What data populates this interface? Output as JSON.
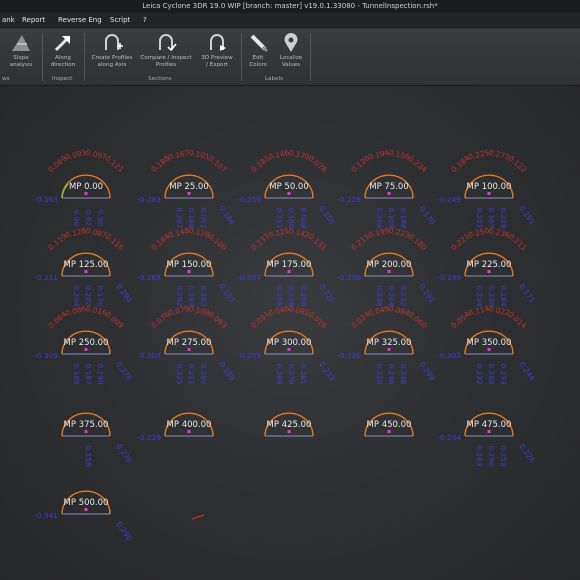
{
  "title": "Leica Cyclone 3DR 19.0 WIP [branch: master] v19.0.1.33080 - TunnelInspection.rsh*",
  "menu": [
    "ank",
    "Report",
    "Reverse Eng",
    "Script",
    "?"
  ],
  "ribbon": {
    "buttons": [
      {
        "label": "Slope\nanalysis",
        "icon": "slope-icon"
      },
      {
        "label": "Along\ndirection",
        "icon": "arrow-icon"
      },
      {
        "label": "Create Profiles\nalong Axis",
        "icon": "profile-add-icon"
      },
      {
        "label": "Compare / Inspect\nProfiles",
        "icon": "profile-check-icon"
      },
      {
        "label": "3D Preview\n/ Export",
        "icon": "profile-export-icon"
      },
      {
        "label": "Edit\nColors",
        "icon": "edit-colors-icon"
      },
      {
        "label": "Localize\nValues",
        "icon": "localize-icon"
      }
    ],
    "groups": [
      "ws",
      "Inspect",
      "Sections",
      "Labels"
    ]
  },
  "colors": {
    "profile_line": "#e07a24",
    "over_label": "#c0322c",
    "under_label": "#3d3fcf",
    "marker": "#e13ad0",
    "ok_line": "#8cbf3a"
  },
  "profiles": [
    {
      "name": "MP 0.00",
      "red": [
        "0.069",
        "0.093",
        "0.097",
        "0.121"
      ],
      "blue": [
        "0.00",
        "0.02",
        "0.00"
      ],
      "left": "0.163",
      "right": ""
    },
    {
      "name": "MP 25.00",
      "red": [
        "0.188",
        "0.167",
        "0.101",
        "0.107"
      ],
      "blue": [
        "0.207",
        "0.168",
        "0.051"
      ],
      "left": "0.283",
      "right": "0.184"
    },
    {
      "name": "MP 50.00",
      "red": [
        "0.181",
        "0.146",
        "0.170",
        "0.078"
      ],
      "blue": [
        "0.251",
        "0.166",
        "0.008"
      ],
      "left": "0.259",
      "right": "0.100"
    },
    {
      "name": "MP 75.00",
      "red": [
        "0.120",
        "0.194",
        "0.156",
        "0.234"
      ],
      "blue": [
        "0.264",
        "0.109",
        "0.198"
      ],
      "left": "0.229",
      "right": "0.170"
    },
    {
      "name": "MP 100.00",
      "red": [
        "0.184",
        "0.225",
        "0.273",
        "0.122"
      ],
      "blue": [
        "0.222",
        "0.167",
        "0.228"
      ],
      "left": "0.249",
      "right": "0.191"
    },
    {
      "name": "MP 125.00",
      "red": [
        "0.119",
        "0.128",
        "0.087",
        "0.116"
      ],
      "blue": [
        "0.204",
        "0.202",
        "0.170"
      ],
      "left": "0.211",
      "right": "0.294"
    },
    {
      "name": "MP 150.00",
      "red": [
        "0.164",
        "0.148",
        "0.128",
        "0.100"
      ],
      "blue": [
        "0.292",
        "0.193",
        "0.163"
      ],
      "left": "0.265",
      "right": "0.157"
    },
    {
      "name": "MP 175.00",
      "red": [
        "0.137",
        "0.121",
        "0.142",
        "0.131"
      ],
      "blue": [
        "0.208",
        "0.248",
        "0.208"
      ],
      "left": "0.267",
      "right": "0.220"
    },
    {
      "name": "MP 200.00",
      "red": [
        "0.211",
        "0.199",
        "0.223",
        "0.180"
      ],
      "blue": [
        "0.236",
        "0.204",
        "0.232"
      ],
      "left": "0.236",
      "right": "0.191"
    },
    {
      "name": "MP 225.00",
      "red": [
        "0.221",
        "0.250",
        "0.236",
        "0.211"
      ],
      "blue": [
        "0.234",
        "0.230",
        "0.184"
      ],
      "left": "0.199",
      "right": "0.175"
    },
    {
      "name": "MP 250.00",
      "red": [
        "0.064",
        "0.086",
        "0.016",
        "0.009"
      ],
      "blue": [
        "0.189",
        "0.187",
        "0.190"
      ],
      "left": "0.309",
      "right": "0.276"
    },
    {
      "name": "MP 275.00",
      "red": [
        "0.076",
        "0.079",
        "0.109",
        "0.093"
      ],
      "blue": [
        "0.325",
        "0.211",
        "0.192"
      ],
      "left": "0.307",
      "right": "0.159"
    },
    {
      "name": "MP 300.00",
      "red": [
        "0.091",
        "0.046",
        "0.082",
        "0.018"
      ],
      "blue": [
        "0.289",
        "0.278",
        "0.261"
      ],
      "left": "0.259",
      "right": "0.233"
    },
    {
      "name": "MP 325.00",
      "red": [
        "0.024",
        "0.049",
        "0.084",
        "0.060"
      ],
      "blue": [
        "0.220",
        "0.236",
        "0.246"
      ],
      "left": "0.230",
      "right": "0.298"
    },
    {
      "name": "MP 350.00",
      "red": [
        "0.054",
        "0.114",
        "0.022",
        "0.014"
      ],
      "blue": [
        "0.232",
        "0.288",
        "0.233"
      ],
      "left": "0.303",
      "right": "0.244"
    },
    {
      "name": "MP 375.00",
      "red": [],
      "blue": [
        "0.158"
      ],
      "left": "",
      "right": "0.230"
    },
    {
      "name": "MP 400.00",
      "red": [],
      "blue": [],
      "left": "0.229",
      "right": ""
    },
    {
      "name": "MP 425.00",
      "red": [],
      "blue": [],
      "left": "",
      "right": ""
    },
    {
      "name": "MP 450.00",
      "red": [],
      "blue": [],
      "left": "",
      "right": ""
    },
    {
      "name": "MP 475.00",
      "red": [],
      "blue": [
        "0.163",
        "0.290",
        "0.253"
      ],
      "left": "0.204",
      "right": "0.226"
    },
    {
      "name": "MP 500.00",
      "red": [],
      "blue": [],
      "left": "0.341",
      "right": "0.290"
    }
  ]
}
